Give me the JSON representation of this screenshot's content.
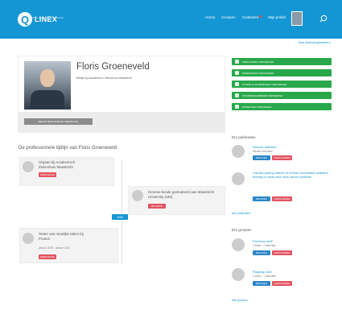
{
  "header": {
    "logo_letter": "Q",
    "logo_name": "LINEX",
    "logo_tagline": "platform medische professionals",
    "nav": [
      {
        "label": "Home"
      },
      {
        "label": "Groepen"
      },
      {
        "label": "Contacten"
      },
      {
        "label": "Mijn profiel"
      }
    ]
  },
  "breadcrumb_link": "Naar Aldersbergkwartier ▸",
  "profile": {
    "name": "Floris Groeneveld",
    "subtitle": "Bekijk bij Academisch Ziekenhuis Maastricht",
    "action_button": "BEKIJK MIJN PROFIEL WEERGAVE"
  },
  "timeline": {
    "heading": "De professionele tijdlijn van Floris Groeneveld",
    "items": [
      {
        "title": "Orgaan bij Academisch Ziekenhuis Maastricht",
        "sub": "",
        "tag": "WERKGEVER"
      },
      {
        "title": "Genees-kunde gestudeerd aan Maastricht University (UM)",
        "sub": "",
        "tag": "OPLEIDING"
      },
      {
        "title": "Tester van mearijke taken bij Protum",
        "sub": "januari 2006 - januari 2010",
        "tag": "WERKGEVER"
      }
    ],
    "year_badge": "2006"
  },
  "side_buttons": [
    {
      "label": "PUBLICATIES TOEVOEGEN"
    },
    {
      "label": "WERKGEVER TOEVOEGEN"
    },
    {
      "label": "STUDIE & OPLEIDINGEN TOEVOEGEN"
    },
    {
      "label": "INTERESSEGEBIEDEN BEWERKEN"
    },
    {
      "label": "EXPERTISE TOEVOEGEN"
    }
  ],
  "publications": {
    "heading": "Eru publicaties",
    "items": [
      {
        "title": "Nieuwe artikelen",
        "sub": "Nieuwe overnave",
        "tag_a": "BEKIJKEN",
        "tag_b": "VERWIJDEREN"
      },
      {
        "title": "Cardiac pacing effects of remote-modulated radiation therapy in head and neck cancer patients",
        "sub": "",
        "tag_a": "BEKIJKEN",
        "tag_b": "VERWIJDEREN"
      }
    ],
    "all_link": "Alle publicaties"
  },
  "groups": {
    "heading": "Eru groepen",
    "items": [
      {
        "title": "Premium stuff",
        "sub": "1 leden · 1 berichten",
        "tag_a": "BEKIJKEN",
        "tag_b": "VERWIJDEREN"
      },
      {
        "title": "Flagship club",
        "sub": "1 leden · 1 berichten",
        "tag_a": "BEKIJKEN",
        "tag_b": "VERWIJDEREN"
      }
    ],
    "all_link": "Alle groepen"
  },
  "colors": {
    "primary": "#1596d4",
    "success": "#29a84b",
    "danger": "#e2535f",
    "info": "#2b86c8"
  },
  "icons": [
    "logo-icon",
    "search-icon",
    "notification-dot",
    "avatar",
    "suitcase-icon",
    "graduation-icon",
    "book-icon",
    "group-icon",
    "plus-icon"
  ]
}
